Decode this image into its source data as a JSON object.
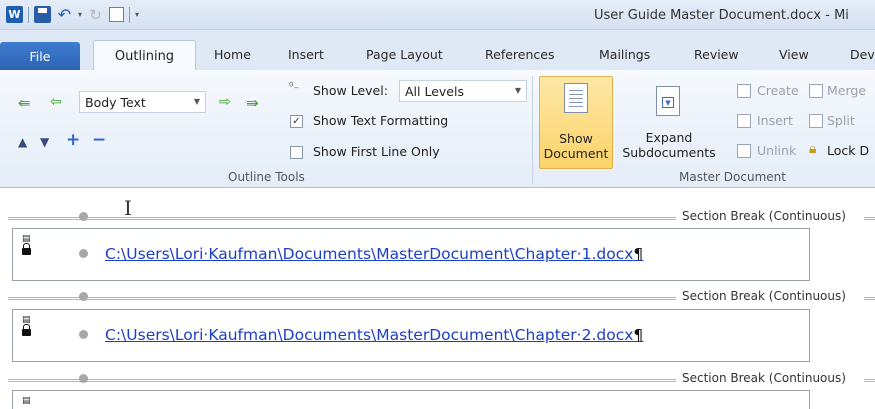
{
  "title_bar": {
    "app_icon": "W",
    "window_title": "User Guide Master Document.docx - Mi"
  },
  "tabs": {
    "file": "File",
    "active": "Outlining",
    "others": [
      "Home",
      "Insert",
      "Page Layout",
      "References",
      "Mailings",
      "Review",
      "View",
      "Dev"
    ]
  },
  "ribbon": {
    "outline_tools": {
      "group_label": "Outline Tools",
      "level_combo_value": "Body Text",
      "show_level_label": "Show Level:",
      "show_level_value": "All Levels",
      "show_text_formatting_label": "Show Text Formatting",
      "show_text_formatting_checked": true,
      "show_first_line_only_label": "Show First Line Only",
      "show_first_line_only_checked": false
    },
    "master_document": {
      "group_label": "Master Document",
      "show_document_line1": "Show",
      "show_document_line2": "Document",
      "expand_line1": "Expand",
      "expand_line2": "Subdocuments",
      "create_label": "Create",
      "insert_label": "Insert",
      "unlink_label": "Unlink",
      "merge_label": "Merge",
      "split_label": "Split",
      "lock_label": "Lock D"
    }
  },
  "document": {
    "section_break_label": "Section Break (Continuous)",
    "subdocuments": [
      {
        "path": "C:\\Users\\Lori·Kaufman\\Documents\\MasterDocument\\Chapter·1.docx",
        "mark": "¶"
      },
      {
        "path": "C:\\Users\\Lori·Kaufman\\Documents\\MasterDocument\\Chapter·2.docx",
        "mark": "¶"
      }
    ]
  },
  "colors": {
    "file_tab": "#2d63b3",
    "show_document_highlight": "#fbd46a",
    "hyperlink": "#1c3fc7"
  }
}
